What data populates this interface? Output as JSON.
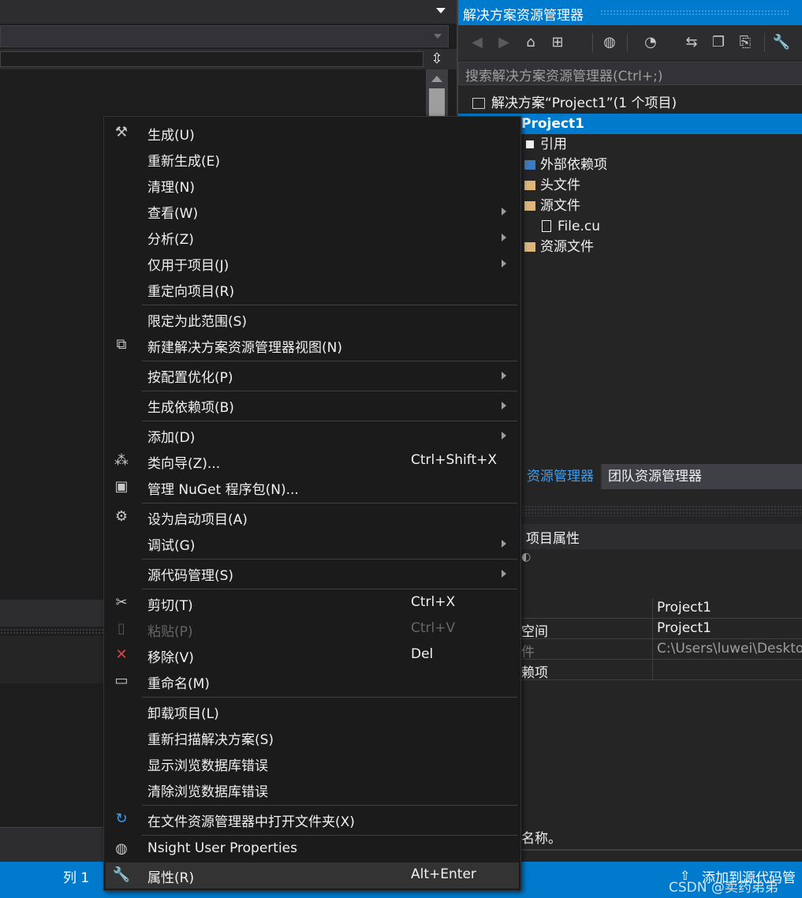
{
  "solution_explorer": {
    "title": "解决方案资源管理器",
    "search_placeholder": "搜索解决方案资源管理器(Ctrl+;)",
    "tree": [
      {
        "label": "解决方案“Project1”(1 个项目)",
        "icon": "solution-icon"
      },
      {
        "label": "Project1",
        "icon": "vcxproj-icon",
        "selected": true
      },
      {
        "label": "引用",
        "icon": "references-icon"
      },
      {
        "label": "外部依赖项",
        "icon": "external-deps-icon"
      },
      {
        "label": "头文件",
        "icon": "folder-icon"
      },
      {
        "label": "源文件",
        "icon": "folder-icon"
      },
      {
        "label": "File.cu",
        "icon": "file-icon"
      },
      {
        "label": "资源文件",
        "icon": "folder-icon"
      }
    ],
    "tabs": {
      "active": "资源管理器",
      "other": "团队资源管理器"
    }
  },
  "properties": {
    "header": "项目属性",
    "rows": [
      {
        "key": "",
        "value": "Project1"
      },
      {
        "key": "空间",
        "value": "Project1"
      },
      {
        "key": "件",
        "value": "C:\\Users\\luwei\\Deskto"
      },
      {
        "key": "赖项",
        "value": ""
      }
    ],
    "description": "名称。"
  },
  "context_menu": {
    "items": [
      {
        "label": "生成(U)",
        "icon": "build-icon"
      },
      {
        "label": "重新生成(E)"
      },
      {
        "label": "清理(N)"
      },
      {
        "label": "查看(W)",
        "submenu": true
      },
      {
        "label": "分析(Z)",
        "submenu": true
      },
      {
        "label": "仅用于项目(J)",
        "submenu": true
      },
      {
        "label": "重定向项目(R)"
      },
      {
        "label": "限定为此范围(S)"
      },
      {
        "label": "新建解决方案资源管理器视图(N)",
        "icon": "new-view-icon"
      },
      {
        "label": "按配置优化(P)",
        "submenu": true
      },
      {
        "label": "生成依赖项(B)",
        "submenu": true
      },
      {
        "label": "添加(D)",
        "submenu": true
      },
      {
        "label": "类向导(Z)...",
        "shortcut": "Ctrl+Shift+X",
        "icon": "class-wizard-icon"
      },
      {
        "label": "管理 NuGet 程序包(N)...",
        "icon": "nuget-icon"
      },
      {
        "label": "设为启动项目(A)",
        "icon": "gear-icon"
      },
      {
        "label": "调试(G)",
        "submenu": true
      },
      {
        "label": "源代码管理(S)",
        "submenu": true
      },
      {
        "label": "剪切(T)",
        "shortcut": "Ctrl+X",
        "icon": "scissors-icon"
      },
      {
        "label": "粘贴(P)",
        "shortcut": "Ctrl+V",
        "icon": "paste-icon",
        "disabled": true
      },
      {
        "label": "移除(V)",
        "shortcut": "Del",
        "icon": "remove-icon"
      },
      {
        "label": "重命名(M)",
        "icon": "rename-icon"
      },
      {
        "label": "卸载项目(L)"
      },
      {
        "label": "重新扫描解决方案(S)"
      },
      {
        "label": "显示浏览数据库错误"
      },
      {
        "label": "清除浏览数据库错误"
      },
      {
        "label": "在文件资源管理器中打开文件夹(X)",
        "icon": "open-folder-icon"
      },
      {
        "label": "Nsight User Properties",
        "icon": "nsight-icon"
      },
      {
        "label": "属性(R)",
        "shortcut": "Alt+Enter",
        "icon": "wrench-icon",
        "hover": true
      }
    ]
  },
  "status_bar": {
    "column": "列 1",
    "add_source": "添加到源代码管",
    "watermark": "CSDN @卖药弟弟"
  },
  "colors": {
    "accent": "#007acc",
    "menu_bg": "#1b1b1c",
    "editor_bg": "#1e1e1e",
    "remove_icon": "#e04343",
    "open_folder_icon": "#3e9ef0"
  }
}
